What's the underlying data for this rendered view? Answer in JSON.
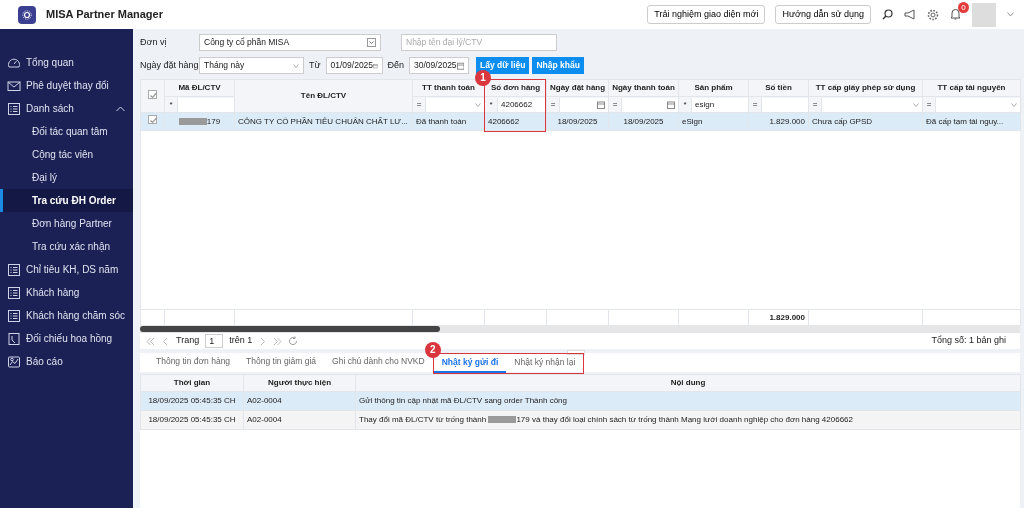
{
  "app": {
    "title": "MISA Partner Manager"
  },
  "header_buttons": [
    "Trải nghiệm giao diện mới",
    "Hướng dẫn sử dụng"
  ],
  "notifications": {
    "count": "0"
  },
  "sidebar": {
    "items": [
      {
        "label": "Tổng quan",
        "kind": "gauge",
        "selected": false
      },
      {
        "label": "Phê duyệt thay đổi",
        "kind": "mail",
        "selected": false
      },
      {
        "label": "Danh sách",
        "kind": "list",
        "selected": false,
        "expanded": true,
        "children": [
          {
            "label": "Đối tác quan tâm",
            "selected": false
          },
          {
            "label": "Cộng tác viên",
            "selected": false
          },
          {
            "label": "Đại lý",
            "selected": false
          },
          {
            "label": "Tra cứu ĐH Order",
            "selected": true
          },
          {
            "label": "Đơn hàng Partner",
            "selected": false
          },
          {
            "label": "Tra cứu xác nhận",
            "selected": false
          }
        ]
      },
      {
        "label": "Chỉ tiêu KH, DS năm",
        "kind": "list",
        "selected": false
      },
      {
        "label": "Khách hàng",
        "kind": "list",
        "selected": false
      },
      {
        "label": "Khách hàng chăm sóc",
        "kind": "list",
        "selected": false
      },
      {
        "label": "Đối chiếu hoa hồng",
        "kind": "clock",
        "selected": false
      },
      {
        "label": "Báo cáo",
        "kind": "chart",
        "selected": false
      }
    ]
  },
  "filters": {
    "unit_label": "Đơn vị",
    "unit_value": "Công ty cổ phần MISA",
    "agent_placeholder": "Nhập tên đại lý/CTV",
    "date_label": "Ngày đặt hàng",
    "period": "Tháng này",
    "from_label": "Từ",
    "from": "01/09/2025",
    "to_label": "Đến",
    "to": "30/09/2025"
  },
  "actions": [
    "Lấy dữ liệu",
    "Nhập khẩu"
  ],
  "table": {
    "all_checked": true,
    "columns": [
      {
        "title": "Mã ĐL/CTV",
        "kind": "text",
        "op": "*"
      },
      {
        "title": "Tên ĐL/CTV",
        "kind": "none"
      },
      {
        "title": "TT thanh toán",
        "kind": "select",
        "op": "="
      },
      {
        "title": "Số đơn hàng",
        "kind": "text",
        "op": "*",
        "value": "4206662",
        "callout": "1"
      },
      {
        "title": "Ngày đặt hàng",
        "kind": "date",
        "op": "="
      },
      {
        "title": "Ngày thanh toán",
        "kind": "date",
        "op": "="
      },
      {
        "title": "Sản phẩm",
        "kind": "text",
        "op": "*",
        "value": "esign"
      },
      {
        "title": "Số tiền",
        "kind": "text",
        "op": "="
      },
      {
        "title": "TT cấp giấy phép sử dụng",
        "kind": "select",
        "op": "="
      },
      {
        "title": "TT cấp tài nguyên",
        "kind": "select",
        "op": "="
      }
    ],
    "rows": [
      {
        "checked": true,
        "selected": true,
        "redacted_code": true,
        "cells": [
          "179",
          "CÔNG TY CỔ PHẦN TIÊU CHUẨN CHẤT LƯ...",
          "Đã thanh toán",
          "4206662",
          "18/09/2025",
          "18/09/2025",
          "eSign",
          "1.829.000",
          "Chưa cấp GPSD",
          "Đã cấp tạm tài nguy..."
        ]
      }
    ],
    "total": "1.829.000"
  },
  "pager": {
    "page_label": "Trang",
    "page": "1",
    "of_label": "trên 1",
    "summary": "Tổng số: 1 bản ghi"
  },
  "detail_tabs": {
    "callout": "2",
    "items": [
      {
        "label": "Thông tin đơn hàng",
        "selected": false,
        "framed": false
      },
      {
        "label": "Thông tin giảm giá",
        "selected": false,
        "framed": false
      },
      {
        "label": "Ghi chú dành cho NVKD",
        "selected": false,
        "framed": false
      },
      {
        "label": "Nhật ký gửi đi",
        "selected": true,
        "framed": true
      },
      {
        "label": "Nhật ký nhận lại",
        "selected": false,
        "framed": true
      }
    ]
  },
  "log": {
    "columns": [
      "Thời gian",
      "Người thực hiện",
      "Nội dung"
    ],
    "rows": [
      {
        "time": "18/09/2025 05:45:35 CH",
        "user": "A02-0004",
        "content": "Gửi thông tin cập nhật mã ĐL/CTV sang order Thành công",
        "selected": true
      },
      {
        "time": "18/09/2025 05:45:35 CH",
        "user": "A02-0004",
        "content": "Thay đổi mã ĐL/CTV từ trống thành ",
        "redacted": true,
        "content_after": "179 và thay đổi loại chính sách từ trống thành Mạng lưới doanh nghiệp cho đơn hàng 4206662",
        "selected": false
      }
    ]
  }
}
